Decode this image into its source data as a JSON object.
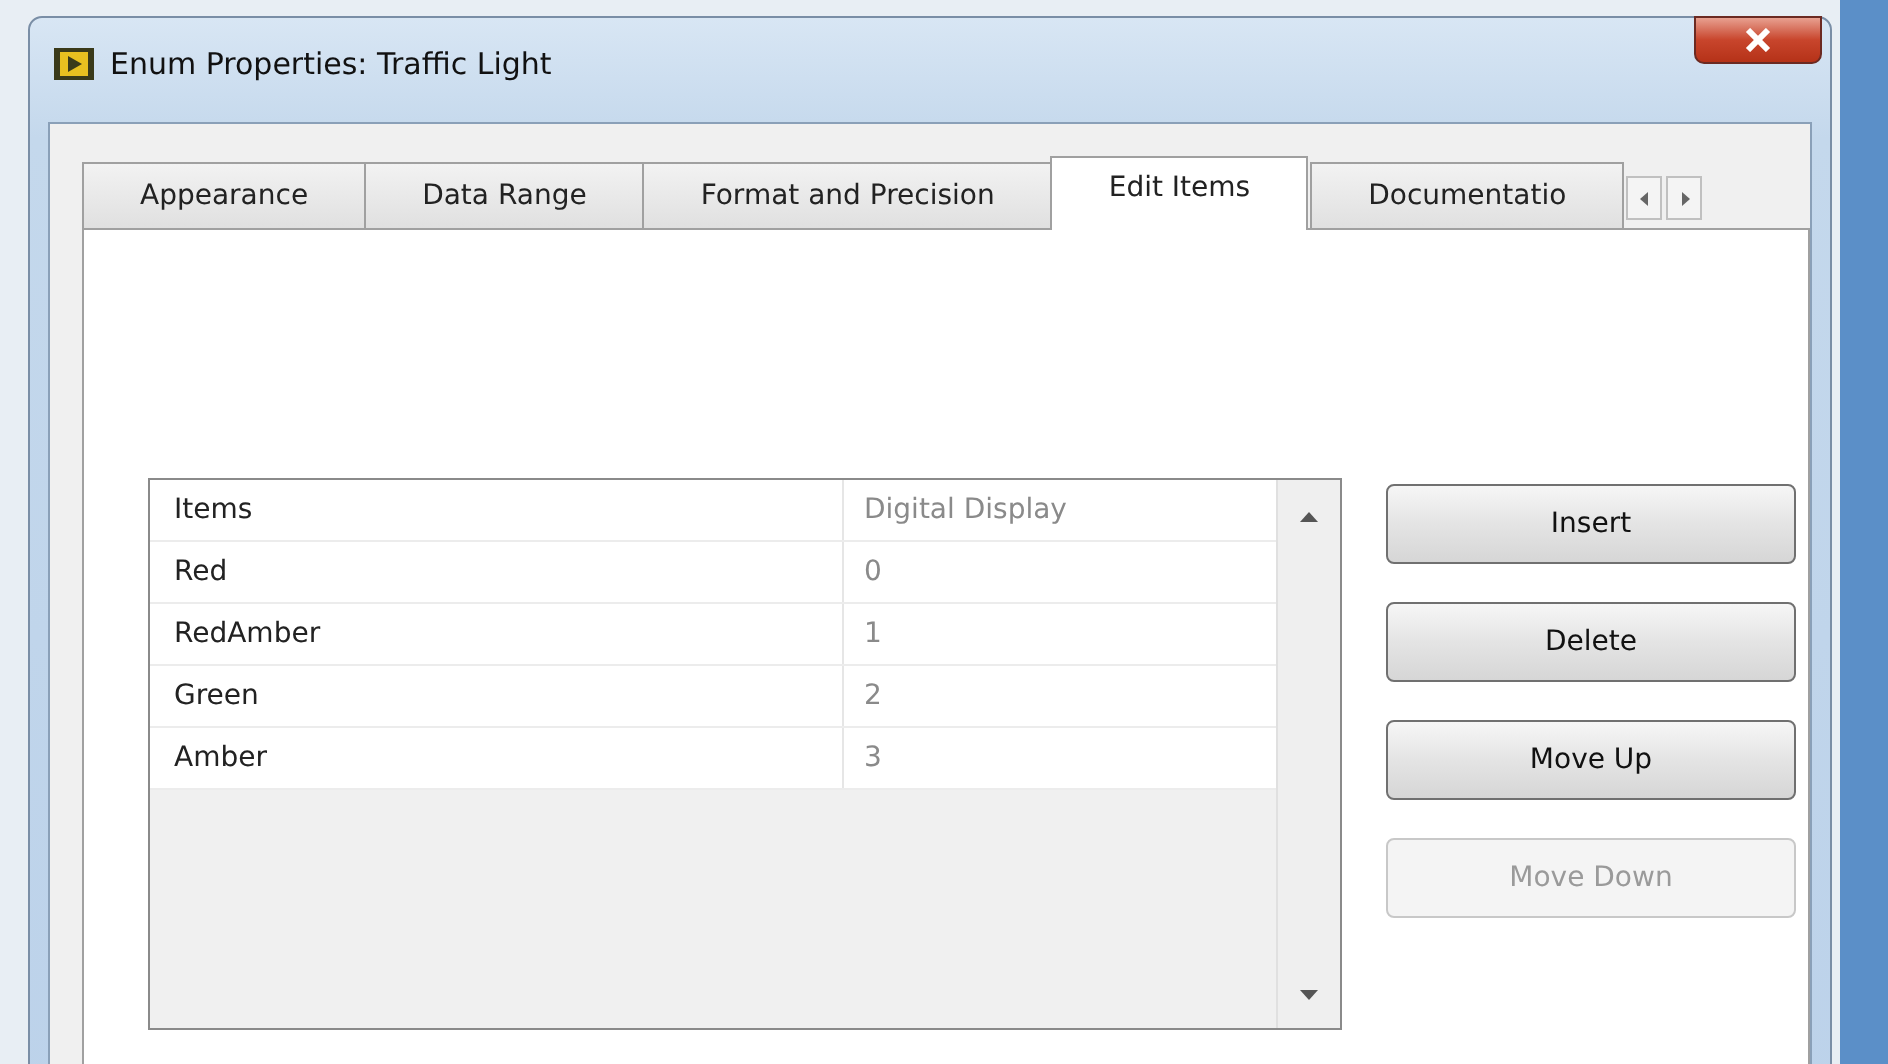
{
  "window": {
    "title": "Enum Properties: Traffic Light"
  },
  "tabs": [
    {
      "label": "Appearance",
      "selected": false
    },
    {
      "label": "Data Range",
      "selected": false
    },
    {
      "label": "Format and Precision",
      "selected": false
    },
    {
      "label": "Edit Items",
      "selected": true
    },
    {
      "label": "Documentatio",
      "selected": false
    }
  ],
  "table": {
    "columns": [
      "Items",
      "Digital Display"
    ],
    "rows": [
      [
        "Red",
        "0"
      ],
      [
        "RedAmber",
        "1"
      ],
      [
        "Green",
        "2"
      ],
      [
        "Amber",
        "3"
      ]
    ]
  },
  "buttons": [
    {
      "label": "Insert",
      "disabled": false
    },
    {
      "label": "Delete",
      "disabled": false
    },
    {
      "label": "Move Up",
      "disabled": false
    },
    {
      "label": "Move Down",
      "disabled": true
    }
  ]
}
